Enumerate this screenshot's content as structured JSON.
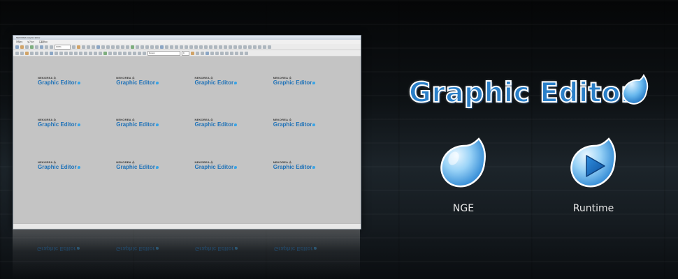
{
  "editor": {
    "window_title": "NEKOREA Graphic Editor",
    "menu": [
      "파일(F)",
      "보기(V)",
      "도움말(H)"
    ],
    "zoom_box": "100%",
    "font_box": "Dotum",
    "size_box": "9"
  },
  "logo_tile": {
    "brand": "NEKOREA 소",
    "title": "Graphic Editor"
  },
  "hero": {
    "title": "Graphic Editor"
  },
  "apps": {
    "nge_label": "NGE",
    "runtime_label": "Runtime"
  },
  "colors": {
    "logo_blue": "#2a7fc8",
    "drop_light": "#bfe3fb",
    "drop_dark": "#1a6fbf"
  },
  "icons": {
    "nge": "water-drop-icon",
    "runtime": "play-drop-icon"
  }
}
